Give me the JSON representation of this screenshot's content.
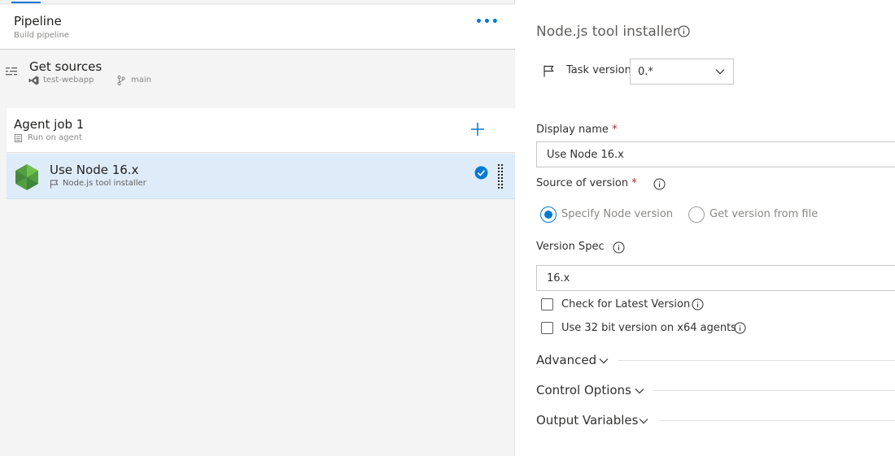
{
  "pipeline": {
    "title": "Pipeline",
    "subtitle": "Build pipeline",
    "more_label": "•••"
  },
  "sources": {
    "title": "Get sources",
    "repo": "test-webapp",
    "branch": "main"
  },
  "agent_job": {
    "title": "Agent job 1",
    "subtitle": "Run on agent"
  },
  "task": {
    "title": "Use Node 16.x",
    "subtitle": "Node.js tool installer",
    "selected": true
  },
  "details": {
    "title": "Node.js tool installer",
    "task_version_label": "Task version",
    "task_version_value": "0.*",
    "display_name_label": "Display name",
    "display_name_value": "Use Node 16.x",
    "required_marker": "*",
    "source_of_version_label": "Source of version",
    "source_options": [
      {
        "label": "Specify Node version",
        "selected": true
      },
      {
        "label": "Get version from file",
        "selected": false
      }
    ],
    "version_spec_label": "Version Spec",
    "version_spec_value": "16.x",
    "check_latest_label": "Check for Latest Version",
    "check_latest_checked": false,
    "use32_label": "Use 32 bit version on x64 agents",
    "use32_checked": false,
    "sections": [
      "Advanced",
      "Control Options",
      "Output Variables"
    ]
  },
  "colors": {
    "accent": "#0078d4",
    "node_green": "#539e43",
    "selected_row": "#deecf9",
    "required": "#a4262c"
  }
}
